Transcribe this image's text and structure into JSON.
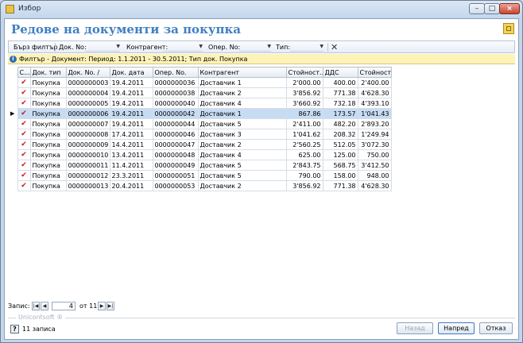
{
  "window": {
    "title": "Избор"
  },
  "page": {
    "title": "Редове на документи за покупка"
  },
  "toolbar": {
    "quick_filter": "Бърз филтър",
    "doc_no_label": "Док. No:",
    "contractor_label": "Контрагент:",
    "oper_no_label": "Опер. No:",
    "type_label": "Тип:"
  },
  "filter_info": "Филтър - Документ: Период: 1.1.2011 - 30.5.2011; Тип док. Покупка",
  "columns": [
    "С...",
    "Док. тип",
    "Док. No. /",
    "Док. дата",
    "Опер. No.",
    "Контрагент",
    "Стойност...",
    "ДДС",
    "Стойност..."
  ],
  "rows": [
    {
      "doc_type": "Покупка",
      "doc_no": "0000000003",
      "date": "19.4.2011",
      "oper_no": "0000000036",
      "contractor": "Доставчик 1",
      "value": "2'000.00",
      "vat": "400.00",
      "total": "2'400.00"
    },
    {
      "doc_type": "Покупка",
      "doc_no": "0000000004",
      "date": "19.4.2011",
      "oper_no": "0000000038",
      "contractor": "Доставчик 2",
      "value": "3'856.92",
      "vat": "771.38",
      "total": "4'628.30"
    },
    {
      "doc_type": "Покупка",
      "doc_no": "0000000005",
      "date": "19.4.2011",
      "oper_no": "0000000040",
      "contractor": "Доставчик 4",
      "value": "3'660.92",
      "vat": "732.18",
      "total": "4'393.10"
    },
    {
      "doc_type": "Покупка",
      "doc_no": "0000000006",
      "date": "19.4.2011",
      "oper_no": "0000000042",
      "contractor": "Доставчик 1",
      "value": "867.86",
      "vat": "173.57",
      "total": "1'041.43",
      "selected": true
    },
    {
      "doc_type": "Покупка",
      "doc_no": "0000000007",
      "date": "19.4.2011",
      "oper_no": "0000000044",
      "contractor": "Доставчик 5",
      "value": "2'411.00",
      "vat": "482.20",
      "total": "2'893.20"
    },
    {
      "doc_type": "Покупка",
      "doc_no": "0000000008",
      "date": "17.4.2011",
      "oper_no": "0000000046",
      "contractor": "Доставчик 3",
      "value": "1'041.62",
      "vat": "208.32",
      "total": "1'249.94"
    },
    {
      "doc_type": "Покупка",
      "doc_no": "0000000009",
      "date": "14.4.2011",
      "oper_no": "0000000047",
      "contractor": "Доставчик 2",
      "value": "2'560.25",
      "vat": "512.05",
      "total": "3'072.30"
    },
    {
      "doc_type": "Покупка",
      "doc_no": "0000000010",
      "date": "13.4.2011",
      "oper_no": "0000000048",
      "contractor": "Доставчик 4",
      "value": "625.00",
      "vat": "125.00",
      "total": "750.00"
    },
    {
      "doc_type": "Покупка",
      "doc_no": "0000000011",
      "date": "11.4.2011",
      "oper_no": "0000000049",
      "contractor": "Доставчик 5",
      "value": "2'843.75",
      "vat": "568.75",
      "total": "3'412.50"
    },
    {
      "doc_type": "Покупка",
      "doc_no": "0000000012",
      "date": "23.3.2011",
      "oper_no": "0000000051",
      "contractor": "Доставчик 5",
      "value": "790.00",
      "vat": "158.00",
      "total": "948.00"
    },
    {
      "doc_type": "Покупка",
      "doc_no": "0000000013",
      "date": "20.4.2011",
      "oper_no": "0000000053",
      "contractor": "Доставчик 2",
      "value": "3'856.92",
      "vat": "771.38",
      "total": "4'628.30"
    }
  ],
  "navigator": {
    "label": "Запис:",
    "position": "4",
    "of": "от 11"
  },
  "footer": {
    "brand": "Unicontsoft ®",
    "records": "11 записа"
  },
  "buttons": {
    "back": "Назад",
    "next": "Напред",
    "cancel": "Отказ"
  }
}
